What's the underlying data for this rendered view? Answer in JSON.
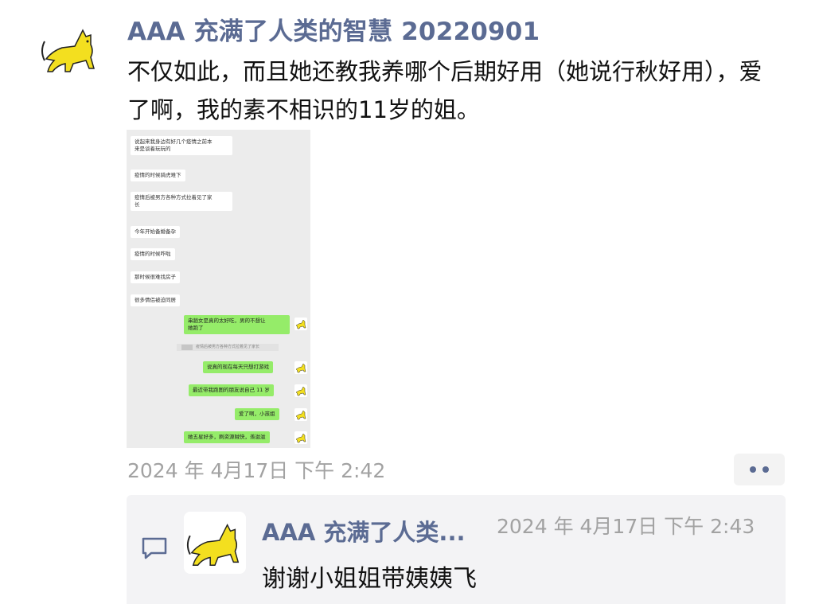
{
  "post": {
    "author": "AAA 充满了人类的智慧 20220901",
    "text": "不仅如此，而且她还教我养哪个后期好用（她说行秋好用），爱了啊，我的素不相识的11岁的姐。",
    "timestamp": "2024 年 4月17日 下午 2:42",
    "avatar_icon": "yellow-cat-icon",
    "more_icon": "more-dots-icon"
  },
  "screenshot": {
    "left_messages": [
      "说起来我身边有好几个疫情之前本\n来是谈着玩玩的",
      "疫情的时候骑虎难下",
      "疫情后被男方各种方式拉着见了家\n长",
      "今年开始备婚备孕",
      "疫情的时候咋啦",
      "那时候很难找房子",
      "很多情侣被迫同居"
    ],
    "right_messages": [
      "串趟女是真的太好吃，男的不想让\n她跑了",
      "说真的现在每天只想打游戏",
      "最近带我跑图的朋友说自己 11 岁",
      "爱了啊，小孩姐",
      "她五星好多，刷资源贼快，羡滋滋"
    ],
    "quote": "疫情后被男方各种方式拉着见了家长"
  },
  "comment": {
    "author": "AAA 充满了人类...",
    "time": "2024 年 4月17日 下午 2:43",
    "text": "谢谢小姐姐带姨姨飞",
    "icon": "comment-icon"
  },
  "colors": {
    "name": "#5b6b93",
    "bubble_green": "#95ec69",
    "time_gray": "#a2a2a2"
  }
}
